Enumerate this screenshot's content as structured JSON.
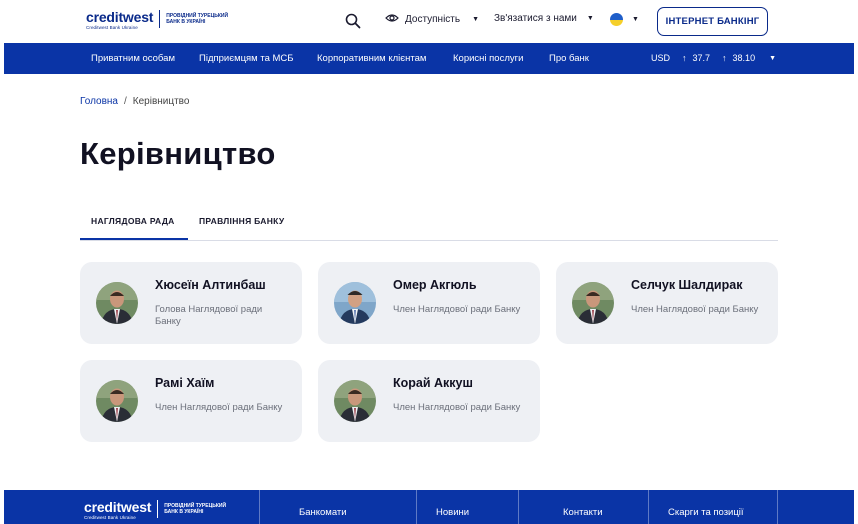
{
  "header": {
    "logo_word": "creditwest",
    "logo_sub": "Creditwest Bank Ukraine",
    "logo_tag": "ПРОВІДНИЙ ТУРЕЦЬКИЙ БАНК В УКРАЇНІ",
    "accessibility_label": "Доступність",
    "contact_label": "Зв'язатися з нами",
    "internet_banking_label": "ІНТЕРНЕТ БАНКІНГ"
  },
  "nav": {
    "items": [
      "Приватним особам",
      "Підприємцям та МСБ",
      "Корпоративним клієнтам",
      "Корисні послуги",
      "Про банк"
    ],
    "currency": "USD",
    "buy": "37.7",
    "sell": "38.10"
  },
  "breadcrumb": {
    "home": "Головна",
    "separator": "/",
    "current": "Керівництво"
  },
  "page_title": "Керівництво",
  "tabs": [
    "НАГЛЯДОВА РАДА",
    "ПРАВЛІННЯ БАНКУ"
  ],
  "members": [
    {
      "name": "Хюсеїн Алтинбаш",
      "role": "Голова Наглядової ради Банку"
    },
    {
      "name": "Омер Акгюль",
      "role": "Член Наглядової ради Банку"
    },
    {
      "name": "Селчук Шалдирак",
      "role": "Член Наглядової ради Банку"
    },
    {
      "name": "Рамі Хаїм",
      "role": "Член Наглядової ради Банку"
    },
    {
      "name": "Корай Аккуш",
      "role": "Член Наглядової ради Банку"
    }
  ],
  "footer": {
    "logo_word": "creditwest",
    "logo_sub": "Creditwest Bank Ukraine",
    "logo_tag": "ПРОВІДНИЙ ТУРЕЦЬКИЙ БАНК В УКРАЇНІ",
    "links": [
      "Банкомати",
      "Новини",
      "Контакти",
      "Скарги та позиції"
    ]
  },
  "colors": {
    "brand_blue": "#0a34a6",
    "logo_blue": "#0a2a8a",
    "card_bg": "#eef0f4"
  }
}
